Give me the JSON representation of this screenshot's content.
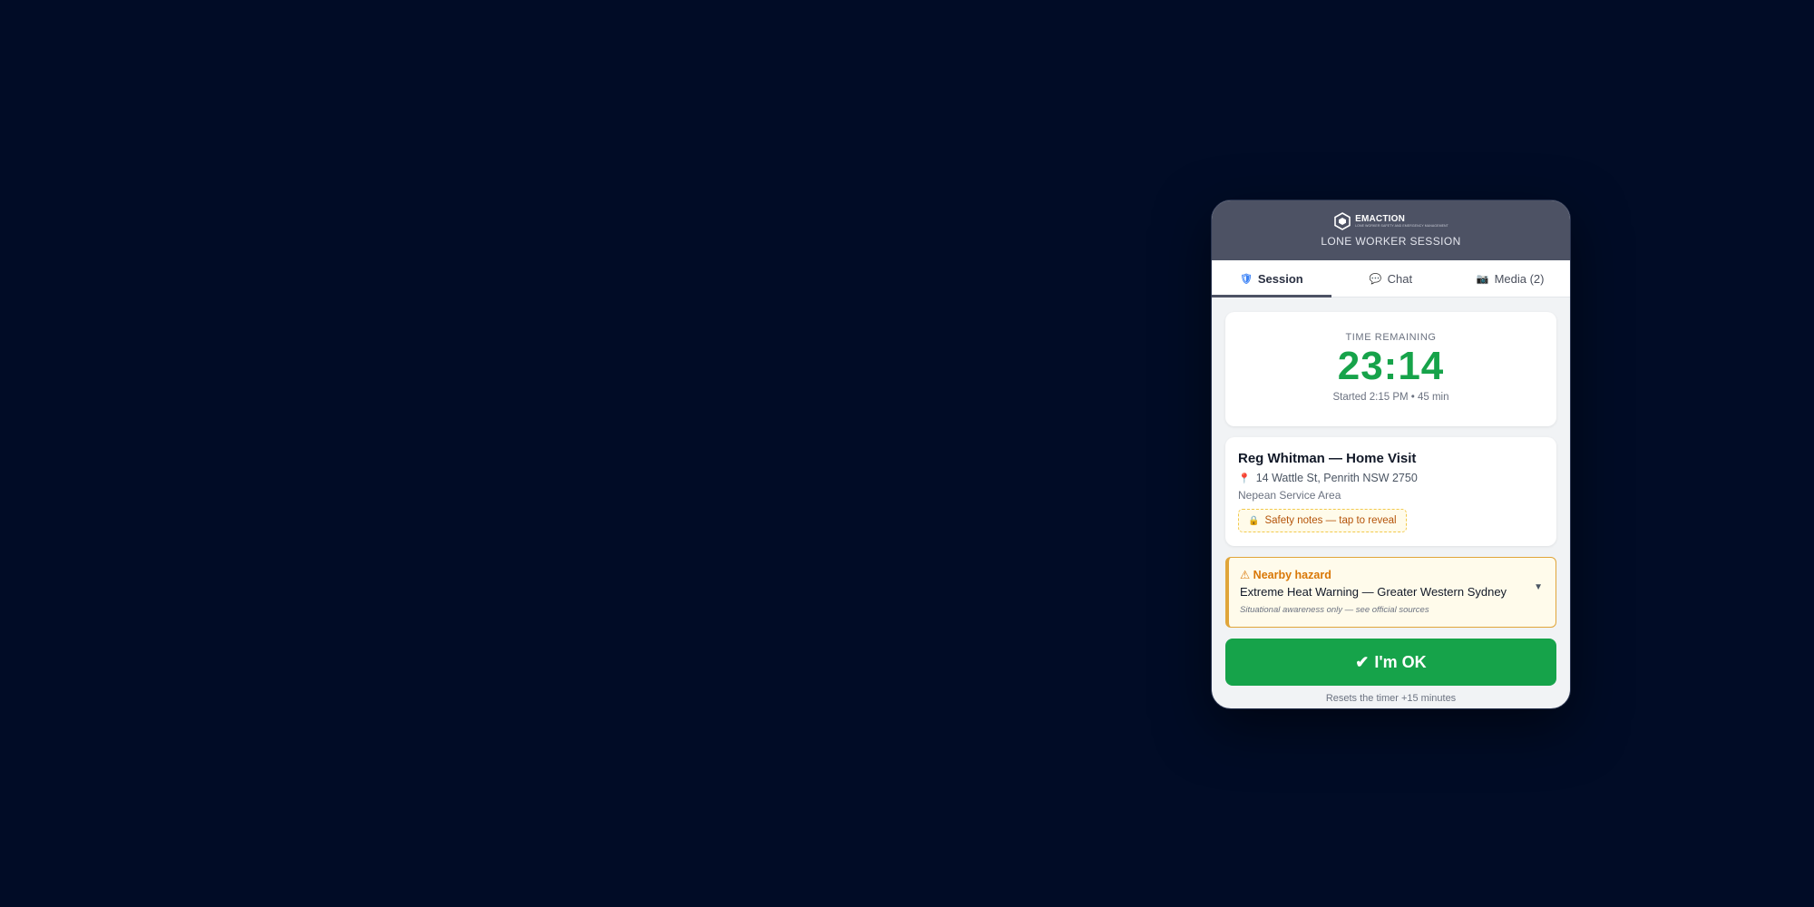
{
  "header": {
    "brand": "EMACTION",
    "tagline": "LONE WORKER SAFETY AND EMERGENCY MANAGEMENT",
    "title": "LONE WORKER SESSION"
  },
  "tabs": [
    {
      "label": "Session",
      "icon": "shield-icon",
      "active": true
    },
    {
      "label": "Chat",
      "icon": "speech-bubble-icon",
      "active": false
    },
    {
      "label": "Media (2)",
      "icon": "camera-icon",
      "active": false
    }
  ],
  "timer": {
    "label": "TIME REMAINING",
    "value": "23:14",
    "subtext": "Started 2:15 PM • 45 min",
    "color": "#16a34a"
  },
  "visit": {
    "title": "Reg Whitman — Home Visit",
    "address": "14 Wattle St, Penrith NSW 2750",
    "area": "Nepean Service Area",
    "safety_label": "Safety notes — tap to reveal"
  },
  "hazard": {
    "heading": "⚠ Nearby hazard",
    "text": "Extreme Heat Warning — Greater Western Sydney",
    "note": "Situational awareness only — see official sources",
    "accent": "#d97706"
  },
  "actions": {
    "ok_label": "I'm OK",
    "ok_subtext": "Resets the timer +15 minutes",
    "ok_color": "#16a34a"
  }
}
